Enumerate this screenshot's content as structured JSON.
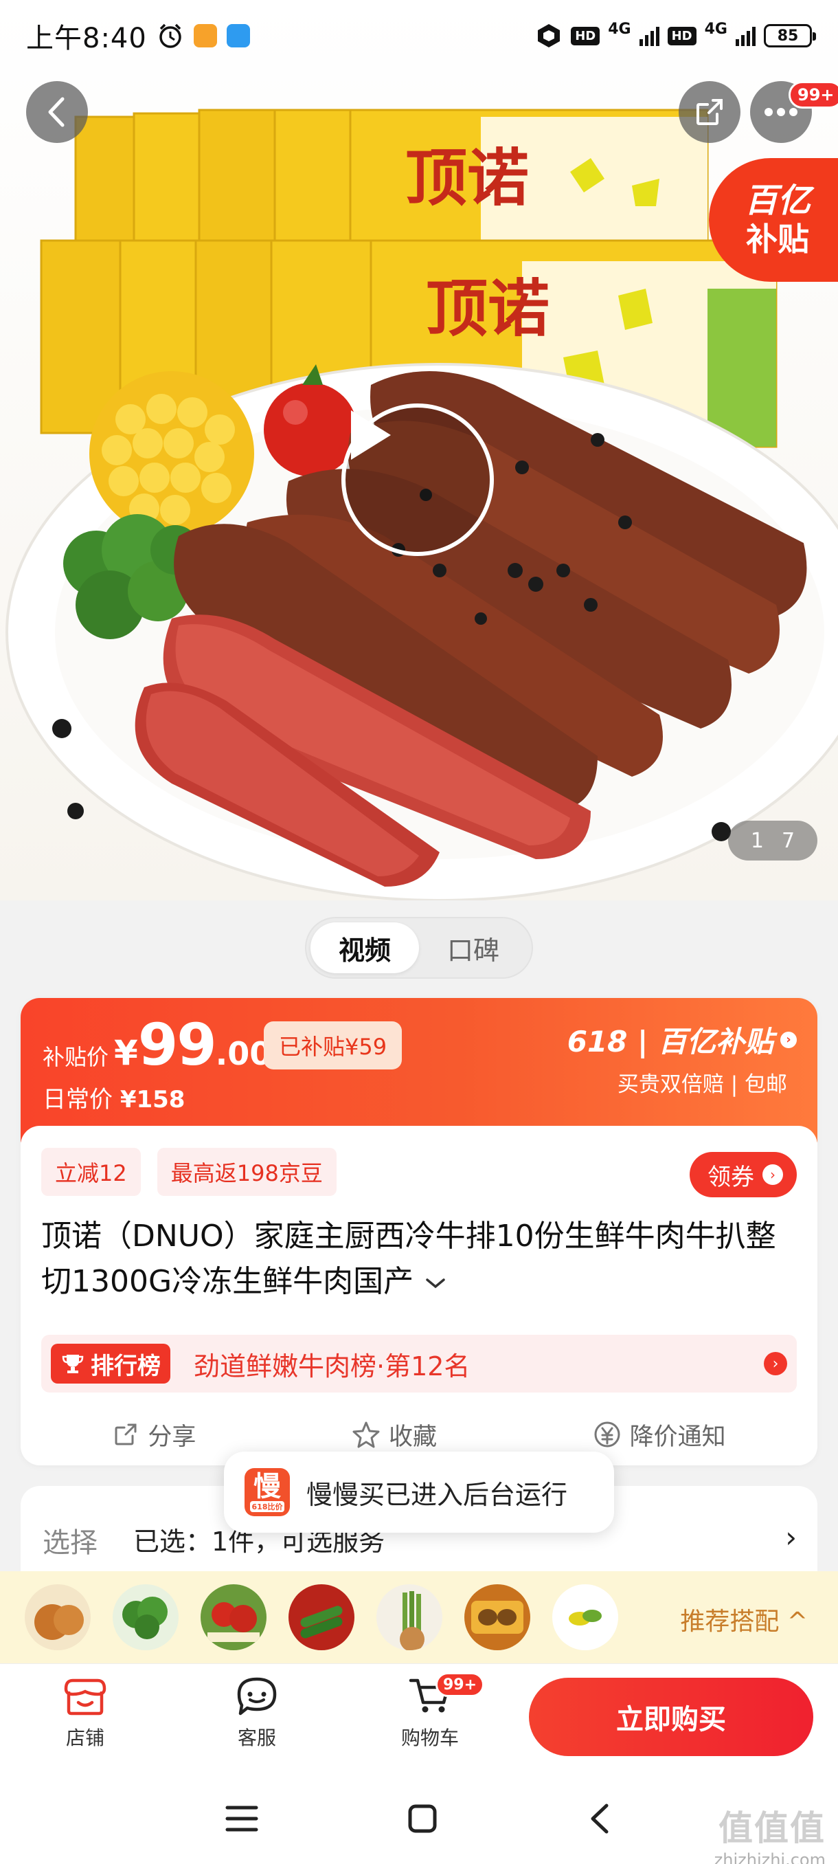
{
  "status_bar": {
    "time": "上午8:40",
    "network_1": "4G",
    "network_2": "4G",
    "hd_1": "HD",
    "hd_2": "HD",
    "battery": "85"
  },
  "header": {
    "more_badge": "99+"
  },
  "hero": {
    "subsidy_tag_line1": "百亿",
    "subsidy_tag_line2": "补贴",
    "page_current": "1",
    "page_total": "7"
  },
  "media_tabs": [
    {
      "label": "视频",
      "active": true
    },
    {
      "label": "口碑",
      "active": false
    }
  ],
  "price": {
    "label": "补贴价",
    "yen": "¥",
    "integer": "99",
    "decimal": ".00",
    "subsidized": "已补贴¥59",
    "daily_label": "日常价",
    "daily_value": "¥158",
    "promo_brand": "618 | 百亿补贴",
    "promo_sub": "买贵双倍赔 | 包邮"
  },
  "tags": [
    "立减12",
    "最高返198京豆"
  ],
  "coupon_label": "领券",
  "product_title": "顶诺（DNUO）家庭主厨西冷牛排10份生鲜牛肉牛扒整切1300G冷冻生鲜牛肉国产",
  "ranking": {
    "badge": "排行榜",
    "text": "劲道鲜嫩牛肉榜·第12名"
  },
  "actions": [
    {
      "label": "分享"
    },
    {
      "label": "收藏"
    },
    {
      "label": "降价通知"
    }
  ],
  "select": {
    "label": "选择",
    "value": "已选：1件，可选服务"
  },
  "toast": {
    "icon_text": "慢",
    "icon_sub": "618比价",
    "text": "慢慢买已进入后台运行"
  },
  "recommend": {
    "label": "推荐搭配 ^"
  },
  "bottom_bar": {
    "store": "店铺",
    "service": "客服",
    "cart": "购物车",
    "cart_badge": "99+",
    "buy": "立即购买"
  },
  "watermark": {
    "line1": "值值值",
    "line2": "zhizhizhi.com"
  },
  "colors": {
    "accent": "#f2362a",
    "price_gradient_start": "#f9442a",
    "recommend_bg": "#fdf6d6"
  }
}
